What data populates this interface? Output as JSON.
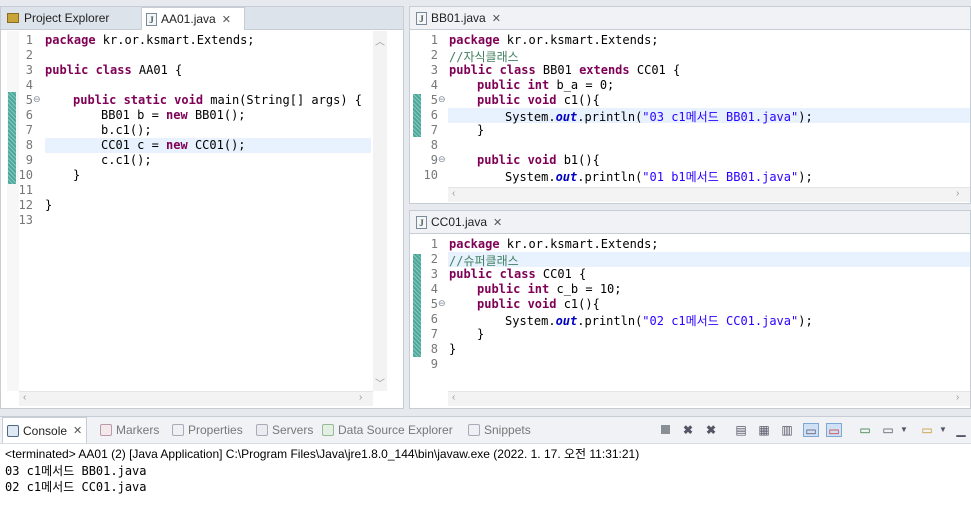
{
  "left_panel": {
    "tabs": [
      {
        "label": "Project Explorer",
        "icon": "project-explorer-icon"
      },
      {
        "label": "AA01.java",
        "icon": "java-file-icon"
      }
    ],
    "line_numbers": [
      "1",
      "2",
      "3",
      "4",
      "5",
      "6",
      "7",
      "8",
      "9",
      "10",
      "11",
      "12",
      "13"
    ]
  },
  "bb01_panel": {
    "tab_label": "BB01.java",
    "line_numbers": [
      "1",
      "2",
      "3",
      "4",
      "5",
      "6",
      "7",
      "8",
      "9",
      "10"
    ]
  },
  "cc01_panel": {
    "tab_label": "CC01.java",
    "line_numbers": [
      "1",
      "2",
      "3",
      "4",
      "5",
      "6",
      "7",
      "8",
      "9"
    ]
  },
  "code": {
    "aa01": {
      "l1_kw": "package",
      "l1_rest": " kr.or.ksmart.Extends;",
      "l3_kw": "public class",
      "l3_rest": " AA01 {",
      "l5_kw": "public static void",
      "l5_rest": " main(String[] args) {",
      "l6_pre": "BB01 b = ",
      "l6_kw": "new",
      "l6_rest": " BB01();",
      "l7": "b.c1();",
      "l8_pre": "CC01 c = ",
      "l8_kw": "new",
      "l8_rest": " CC01();",
      "l9": "c.c1();",
      "l10": "}",
      "l12": "}"
    },
    "bb01": {
      "l1_kw": "package",
      "l1_rest": " kr.or.ksmart.Extends;",
      "l2_comment": "//자식클래스",
      "l3_kw": "public class",
      "l3_mid": " BB01 ",
      "l3_kw2": "extends",
      "l3_rest": " CC01 {",
      "l4_kw": "public int",
      "l4_rest": " b_a = 0;",
      "l5_kw": "public void",
      "l5_rest": " c1(){",
      "l6_pre": "System.",
      "l6_field": "out",
      "l6_mid": ".println(",
      "l6_str": "\"03 c1메서드 BB01.java\"",
      "l6_end": ");",
      "l7": "}",
      "l9_kw": "public void",
      "l9_rest": " b1(){",
      "l10_pre": "System.",
      "l10_field": "out",
      "l10_mid": ".println(",
      "l10_str": "\"01 b1메서드 BB01.java\"",
      "l10_end": ");"
    },
    "cc01": {
      "l1_kw": "package",
      "l1_rest": " kr.or.ksmart.Extends;",
      "l2_comment": "//슈퍼클래스",
      "l3_kw": "public class",
      "l3_rest": " CC01 {",
      "l4_kw": "public int",
      "l4_rest": " c_b = 10;",
      "l5_kw": "public void",
      "l5_rest": " c1(){",
      "l6_pre": "System.",
      "l6_field": "out",
      "l6_mid": ".println(",
      "l6_str": "\"02 c1메서드 CC01.java\"",
      "l6_end": ");",
      "l7": "}",
      "l8": "}"
    }
  },
  "console": {
    "tabs": [
      {
        "label": "Console",
        "icon": "console-icon"
      },
      {
        "label": "Markers",
        "icon": "markers-icon"
      },
      {
        "label": "Properties",
        "icon": "properties-icon"
      },
      {
        "label": "Servers",
        "icon": "servers-icon"
      },
      {
        "label": "Data Source Explorer",
        "icon": "data-source-icon"
      },
      {
        "label": "Snippets",
        "icon": "snippets-icon"
      }
    ],
    "status_line": "<terminated> AA01 (2) [Java Application] C:\\Program Files\\Java\\jre1.8.0_144\\bin\\javaw.exe (2022. 1. 17. 오전 11:31:21)",
    "output": [
      "03 c1메서드 BB01.java",
      "02 c1메서드 CC01.java"
    ]
  },
  "colors": {
    "keyword": "#7f0055",
    "comment": "#3f7f5f",
    "string": "#2a00ff",
    "static_field": "#0000c0",
    "current_line": "#e8f2fe",
    "override_marker": "#4ba89b"
  }
}
